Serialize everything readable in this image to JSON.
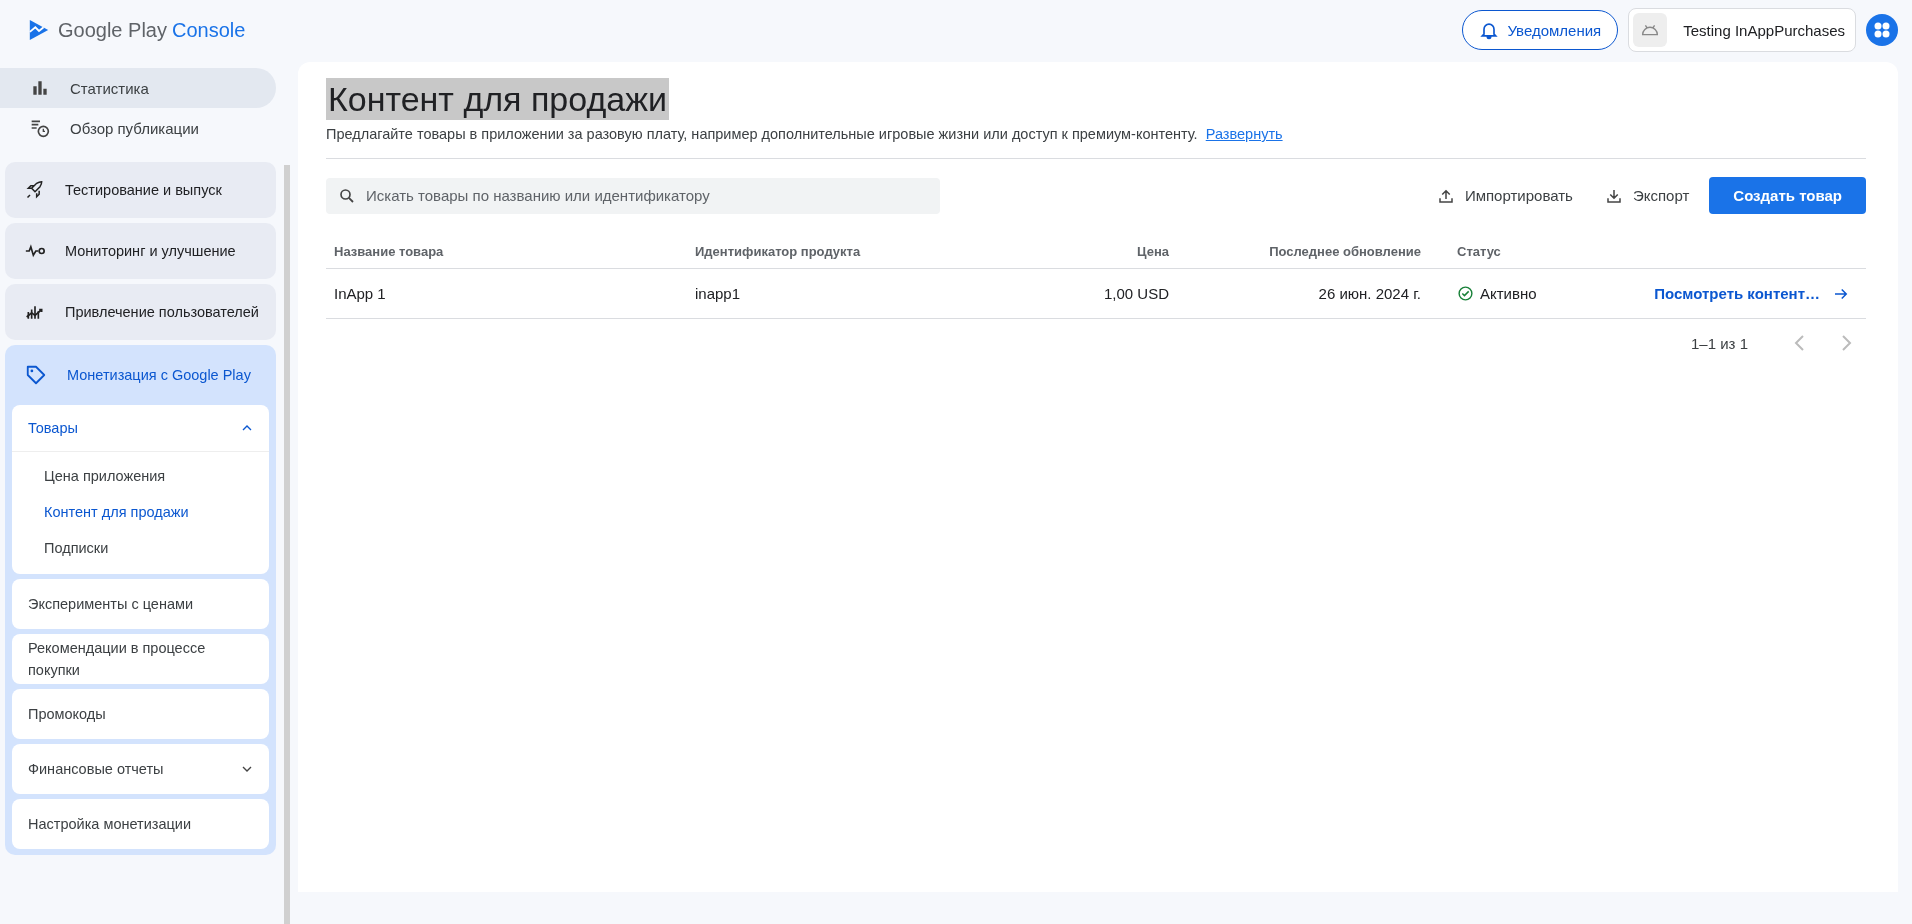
{
  "header": {
    "logo": {
      "brand": "Google Play",
      "product": "Console"
    },
    "notifications": "Уведомления",
    "app_name": "Testing InAppPurchases"
  },
  "sidebar": {
    "top_items": [
      {
        "label": "Статистика",
        "kind": "bars",
        "selected": true
      },
      {
        "label": "Обзор публикации",
        "kind": "schedule",
        "selected": false
      }
    ],
    "sections": [
      {
        "label": "Тестирование и выпуск",
        "kind": "rocket",
        "expanded": false
      },
      {
        "label": "Мониторинг и улучшение",
        "kind": "pulse",
        "expanded": false
      },
      {
        "label": "Привлечение пользователей",
        "kind": "growth",
        "expanded": false
      },
      {
        "label": "Монетизация с Google Play",
        "kind": "tag",
        "expanded": true,
        "children": [
          {
            "label": "Товары",
            "expanded": true,
            "children": [
              {
                "label": "Цена приложения",
                "selected": false
              },
              {
                "label": "Контент для продажи",
                "selected": true
              },
              {
                "label": "Подписки",
                "selected": false
              }
            ]
          },
          {
            "label": "Эксперименты с ценами"
          },
          {
            "label": "Рекомендации в процессе покупки"
          },
          {
            "label": "Промокоды"
          },
          {
            "label": "Финансовые отчеты",
            "expanded": false
          },
          {
            "label": "Настройка монетизации"
          }
        ]
      }
    ]
  },
  "main": {
    "title": {
      "text": "Контент для продажи",
      "highlighted": true
    },
    "description": "Предлагайте товары в приложении за разовую плату, например дополнительные игровые жизни или доступ к премиум-контенту.",
    "description_link": "Развернуть",
    "search": {
      "placeholder": "Искать товары по названию или идентификатору"
    },
    "actions": [
      {
        "label": "Импортировать",
        "kind": "upload"
      },
      {
        "label": "Экспорт",
        "kind": "download"
      }
    ],
    "primary_button": "Создать товар",
    "table": {
      "columns": [
        "Название товара",
        "Идентификатор продукта",
        "Цена",
        "Последнее обновление",
        "Статус"
      ],
      "rows": [
        {
          "name": "InApp 1",
          "product_id": "inapp1",
          "price": "1,00 USD",
          "updated": "26 июн. 2024 г.",
          "status": {
            "text": "Активно",
            "kind": "active"
          },
          "action": "Посмотреть контент…"
        }
      ]
    },
    "pagination": {
      "range": "1–1 из 1",
      "prev_disabled": true,
      "next_disabled": true
    }
  }
}
